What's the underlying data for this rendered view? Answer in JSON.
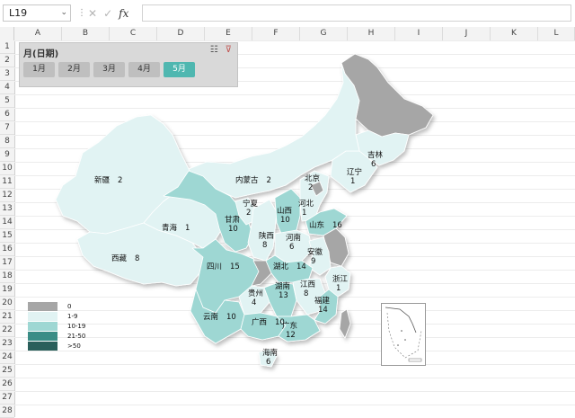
{
  "formula_bar": {
    "name_box": "L19",
    "name_box_dropdown": "⌄",
    "separator": "⋮",
    "cancel": "✕",
    "confirm": "✓",
    "fx": "fx",
    "formula": ""
  },
  "columns": [
    "A",
    "B",
    "C",
    "D",
    "E",
    "F",
    "G",
    "H",
    "I",
    "J",
    "K",
    "L"
  ],
  "rows": [
    "1",
    "2",
    "3",
    "4",
    "5",
    "6",
    "7",
    "8",
    "9",
    "10",
    "11",
    "12",
    "13",
    "14",
    "15",
    "16",
    "17",
    "18",
    "19",
    "20",
    "21",
    "22",
    "23",
    "24",
    "25",
    "26",
    "27",
    "28"
  ],
  "slicer": {
    "title": "月(日期)",
    "buttons": [
      {
        "label": "1月",
        "active": false
      },
      {
        "label": "2月",
        "active": false
      },
      {
        "label": "3月",
        "active": false
      },
      {
        "label": "4月",
        "active": false
      },
      {
        "label": "5月",
        "active": true
      }
    ],
    "multi_select_icon": "☷",
    "clear_filter_icon": "⊽"
  },
  "colors": {
    "c0": "#a6a6a6",
    "c1_9": "#e1f3f3",
    "c10_19": "#9ed7d3",
    "c21_50": "#3a8d86",
    "c50p": "#2a5f5b",
    "accent": "#4fb7b0"
  },
  "legend": [
    {
      "label": "0",
      "color": "#a6a6a6"
    },
    {
      "label": "1-9",
      "color": "#e1f3f3"
    },
    {
      "label": "10-19",
      "color": "#9ed7d3"
    },
    {
      "label": "21-50",
      "color": "#3a8d86"
    },
    {
      "label": ">50",
      "color": "#2a5f5b"
    }
  ],
  "provinces": [
    {
      "name": "新疆",
      "value": "2"
    },
    {
      "name": "西藏",
      "value": "8"
    },
    {
      "name": "青海",
      "value": "1"
    },
    {
      "name": "甘肃",
      "value": "10"
    },
    {
      "name": "宁夏",
      "value": "2"
    },
    {
      "name": "内蒙古",
      "value": "2"
    },
    {
      "name": "陕西",
      "value": "8"
    },
    {
      "name": "山西",
      "value": "10"
    },
    {
      "name": "北京",
      "value": "2"
    },
    {
      "name": "河北",
      "value": "1"
    },
    {
      "name": "辽宁",
      "value": "1"
    },
    {
      "name": "吉林",
      "value": "6"
    },
    {
      "name": "山东",
      "value": "16"
    },
    {
      "name": "河南",
      "value": "6"
    },
    {
      "name": "四川",
      "value": "15"
    },
    {
      "name": "湖北",
      "value": "14"
    },
    {
      "name": "安徽",
      "value": "9"
    },
    {
      "name": "浙江",
      "value": "1"
    },
    {
      "name": "贵州",
      "value": "4"
    },
    {
      "name": "湖南",
      "value": "13"
    },
    {
      "name": "江西",
      "value": "8"
    },
    {
      "name": "福建",
      "value": "14"
    },
    {
      "name": "云南",
      "value": "10"
    },
    {
      "name": "广西",
      "value": "10"
    },
    {
      "name": "广东",
      "value": "12"
    },
    {
      "name": "海南",
      "value": "6"
    }
  ]
}
